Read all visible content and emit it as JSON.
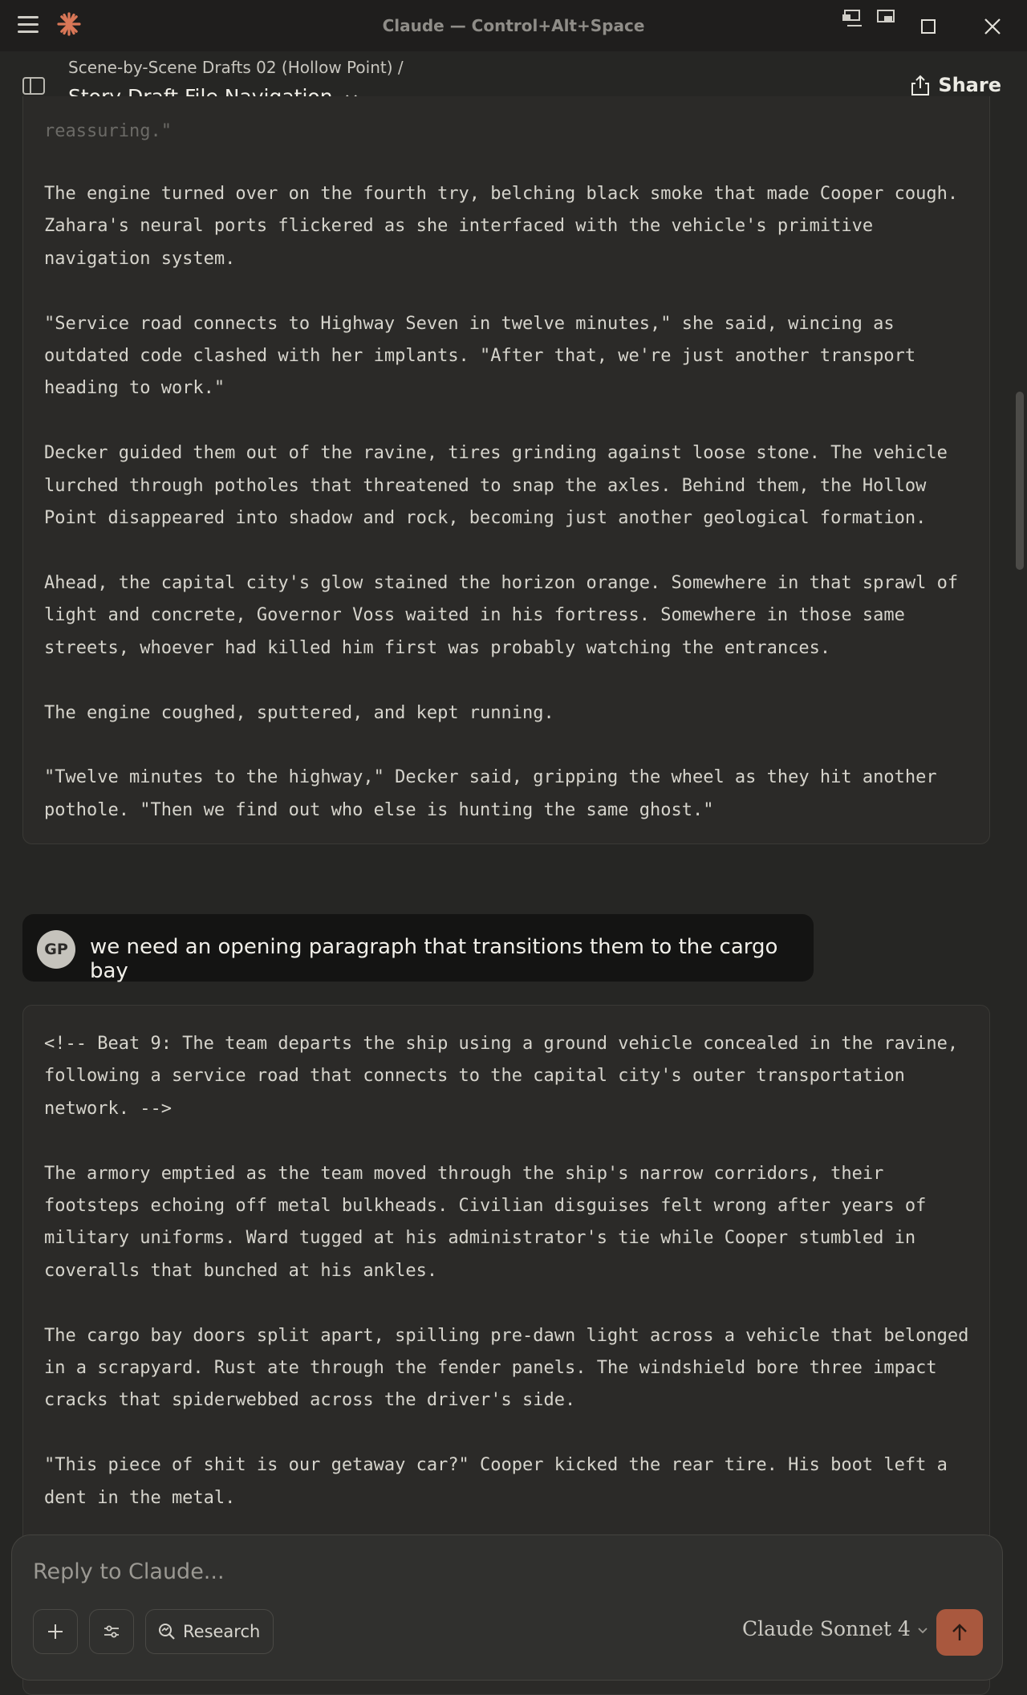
{
  "app": {
    "title": "Claude — Control+Alt+Space",
    "brand_color": "#d97757"
  },
  "header": {
    "breadcrumb": "Scene-by-Scene Drafts 02 (Hollow Point) /",
    "title": "Story Draft File Navigation",
    "share_label": "Share"
  },
  "previous_response": {
    "faded_line": "reassuring.\"",
    "text": "The engine turned over on the fourth try, belching black smoke that made Cooper cough.\nZahara's neural ports flickered as she interfaced with the vehicle's primitive\nnavigation system.\n\n\"Service road connects to Highway Seven in twelve minutes,\" she said, wincing as\noutdated code clashed with her implants. \"After that, we're just another transport\nheading to work.\"\n\nDecker guided them out of the ravine, tires grinding against loose stone. The vehicle\nlurched through potholes that threatened to snap the axles. Behind them, the Hollow\nPoint disappeared into shadow and rock, becoming just another geological formation.\n\nAhead, the capital city's glow stained the horizon orange. Somewhere in that sprawl of\nlight and concrete, Governor Voss waited in his fortress. Somewhere in those same\nstreets, whoever had killed him first was probably watching the entrances.\n\nThe engine coughed, sputtered, and kept running.\n\n\"Twelve minutes to the highway,\" Decker said, gripping the wheel as they hit another\npothole. \"Then we find out who else is hunting the same ghost.\""
  },
  "user_message": {
    "initials": "GP",
    "text": "we need an opening paragraph that transitions them to the cargo bay"
  },
  "current_response": {
    "text": "<!-- Beat 9: The team departs the ship using a ground vehicle concealed in the ravine,\nfollowing a service road that connects to the capital city's outer transportation\nnetwork. -->\n\nThe armory emptied as the team moved through the ship's narrow corridors, their\nfootsteps echoing off metal bulkheads. Civilian disguises felt wrong after years of\nmilitary uniforms. Ward tugged at his administrator's tie while Cooper stumbled in\ncoveralls that bunched at his ankles.\n\nThe cargo bay doors split apart, spilling pre-dawn light across a vehicle that belonged\nin a scrapyard. Rust ate through the fender panels. The windshield bore three impact\ncracks that spiderwebbed across the driver's side.\n\n\"This piece of shit is our getaway car?\" Cooper kicked the rear tire. His boot left a\ndent in the metal."
  },
  "composer": {
    "placeholder": "Reply to Claude...",
    "research_label": "Research",
    "model_label": "Claude Sonnet 4",
    "send_color": "#a9583e"
  }
}
